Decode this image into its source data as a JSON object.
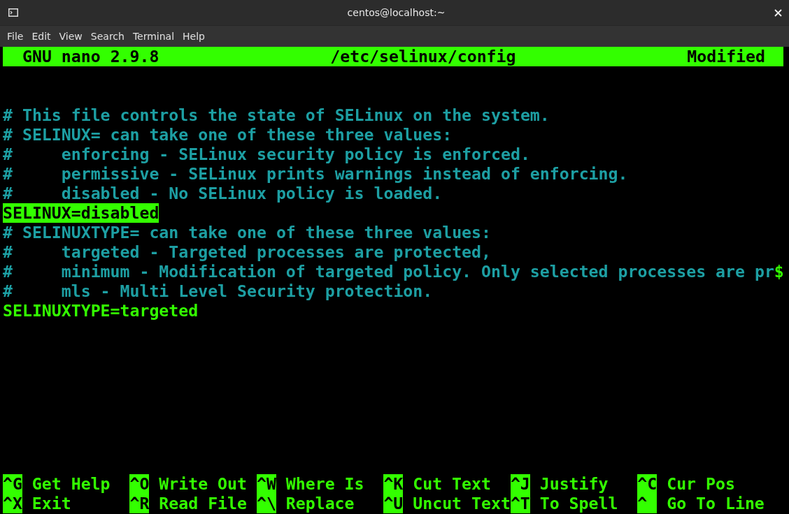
{
  "window": {
    "title": "centos@localhost:~"
  },
  "menu": [
    "File",
    "Edit",
    "View",
    "Search",
    "Terminal",
    "Help"
  ],
  "nano_header": {
    "version": "GNU nano 2.9.8",
    "file": "/etc/selinux/config",
    "status": "Modified"
  },
  "lines": [
    {
      "kind": "comment",
      "text": "# This file controls the state of SELinux on the system.",
      "selected": false
    },
    {
      "kind": "comment",
      "text": "# SELINUX= can take one of these three values:",
      "selected": false
    },
    {
      "kind": "comment",
      "text": "#     enforcing - SELinux security policy is enforced.",
      "selected": false
    },
    {
      "kind": "comment",
      "text": "#     permissive - SELinux prints warnings instead of enforcing.",
      "selected": false
    },
    {
      "kind": "comment",
      "text": "#     disabled - No SELinux policy is loaded.",
      "selected": false
    },
    {
      "kind": "setting",
      "text": "SELINUX=disabled",
      "selected": true
    },
    {
      "kind": "comment",
      "text": "# SELINUXTYPE= can take one of these three values:",
      "selected": false
    },
    {
      "kind": "comment",
      "text": "#     targeted - Targeted processes are protected,",
      "selected": false
    },
    {
      "kind": "comment",
      "text": "#     minimum - Modification of targeted policy. Only selected processes are pr",
      "selected": false,
      "overflow_mark": "$"
    },
    {
      "kind": "comment",
      "text": "#     mls - Multi Level Security protection.",
      "selected": false
    },
    {
      "kind": "setting",
      "text": "SELINUXTYPE=targeted",
      "selected": false
    }
  ],
  "shortcuts": [
    {
      "key": "^G",
      "label": "Get Help"
    },
    {
      "key": "^O",
      "label": "Write Out"
    },
    {
      "key": "^W",
      "label": "Where Is"
    },
    {
      "key": "^K",
      "label": "Cut Text"
    },
    {
      "key": "^J",
      "label": "Justify"
    },
    {
      "key": "^C",
      "label": "Cur Pos"
    },
    {
      "key": "^X",
      "label": "Exit"
    },
    {
      "key": "^R",
      "label": "Read File"
    },
    {
      "key": "^\\",
      "label": "Replace"
    },
    {
      "key": "^U",
      "label": "Uncut Text"
    },
    {
      "key": "^T",
      "label": "To Spell"
    },
    {
      "key": "^",
      "label": "Go To Line"
    }
  ]
}
